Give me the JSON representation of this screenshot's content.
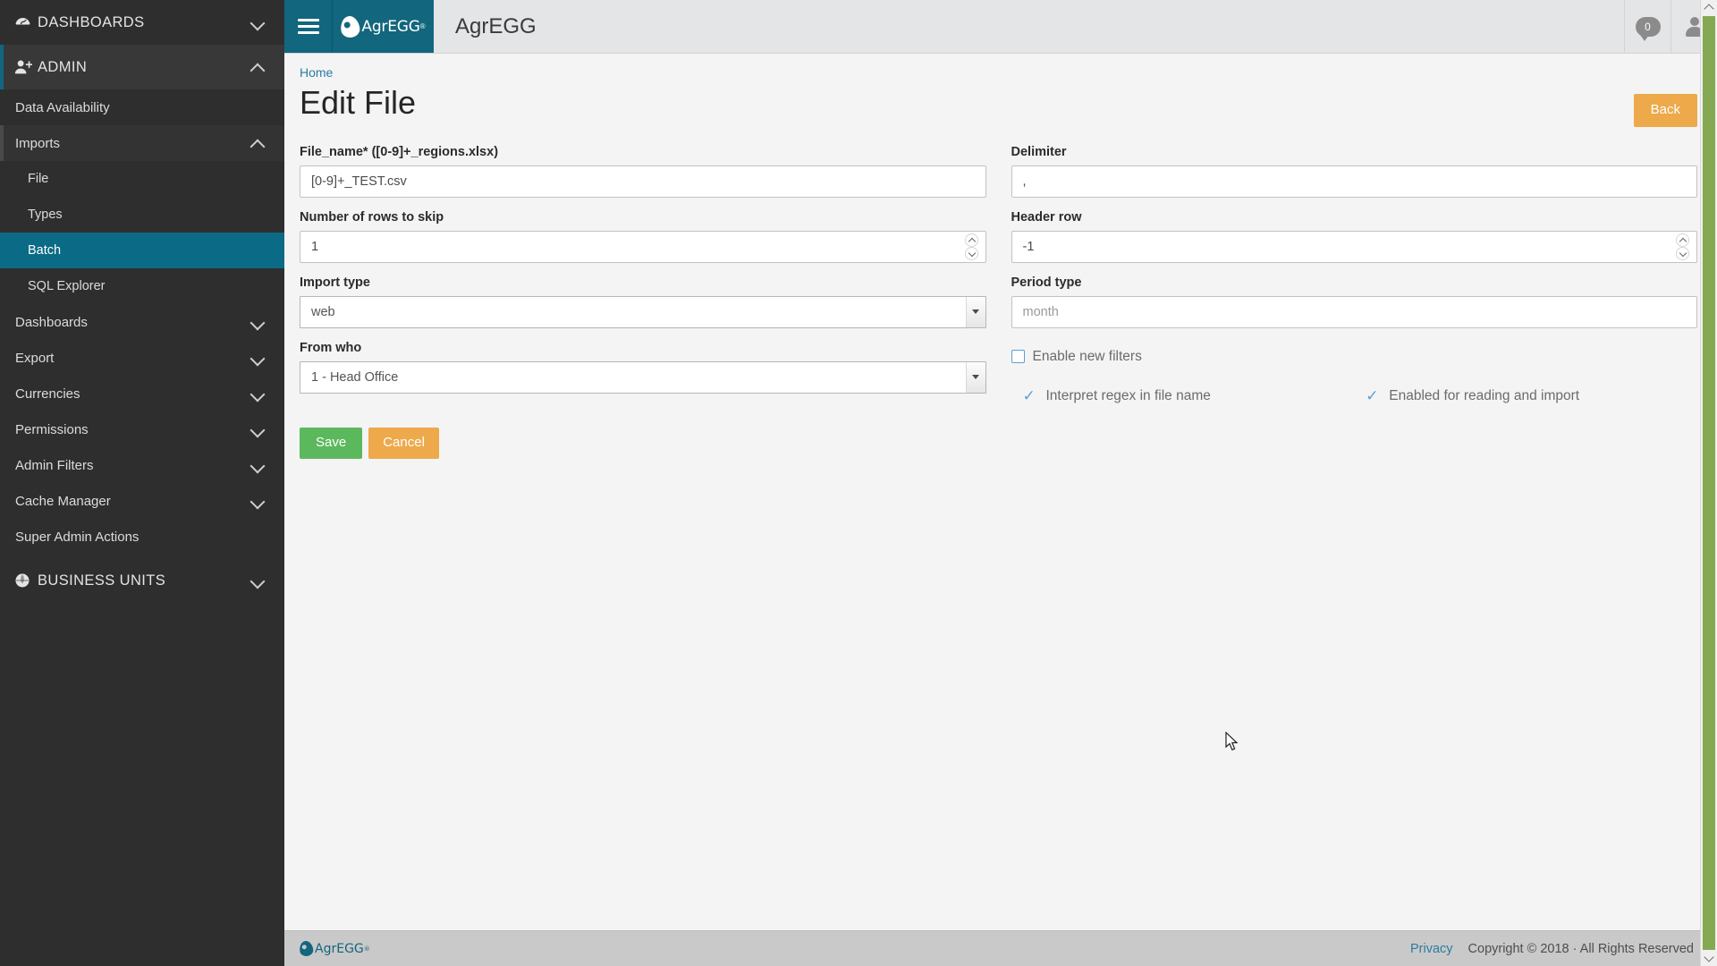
{
  "sidebar": {
    "groups": [
      {
        "label": "DASHBOARDS",
        "icon": "dashboard-gauge-icon",
        "expanded": false
      },
      {
        "label": "ADMIN",
        "icon": "user-add-icon",
        "expanded": true
      },
      {
        "label": "BUSINESS UNITS",
        "icon": "globe-icon",
        "expanded": false
      }
    ],
    "admin_items": [
      {
        "label": "Data Availability",
        "type": "item",
        "state": "normal"
      },
      {
        "label": "Imports",
        "type": "group",
        "state": "open"
      },
      {
        "label": "File",
        "type": "sub",
        "state": "normal"
      },
      {
        "label": "Types",
        "type": "sub",
        "state": "normal"
      },
      {
        "label": "Batch",
        "type": "sub",
        "state": "active"
      },
      {
        "label": "SQL Explorer",
        "type": "sub",
        "state": "normal"
      },
      {
        "label": "Dashboards",
        "type": "group",
        "state": "collapsed"
      },
      {
        "label": "Export",
        "type": "group",
        "state": "collapsed"
      },
      {
        "label": "Currencies",
        "type": "group",
        "state": "collapsed"
      },
      {
        "label": "Permissions",
        "type": "group",
        "state": "collapsed"
      },
      {
        "label": "Admin Filters",
        "type": "group",
        "state": "collapsed"
      },
      {
        "label": "Cache Manager",
        "type": "group",
        "state": "collapsed"
      },
      {
        "label": "Super Admin Actions",
        "type": "item",
        "state": "normal"
      }
    ]
  },
  "topbar": {
    "brand": "AgrEGG",
    "brand_reg": "®",
    "app_title": "AgrEGG",
    "menu_icon": "hamburger-menu-icon",
    "messages_count": "0",
    "messages_icon": "message-bubble-icon",
    "account_icon": "user-account-icon"
  },
  "breadcrumb": {
    "home": "Home"
  },
  "page": {
    "title": "Edit File",
    "back_label": "Back"
  },
  "form": {
    "left": {
      "file_name_label": "File_name* ([0-9]+_regions.xlsx)",
      "file_name_value": "[0-9]+_TEST.csv",
      "rows_skip_label": "Number of rows to skip",
      "rows_skip_value": "1",
      "import_type_label": "Import type",
      "import_type_value": "web",
      "import_type_options": [
        "web"
      ],
      "from_who_label": "From who",
      "from_who_value": "1 - Head Office",
      "from_who_options": [
        "1 - Head Office"
      ]
    },
    "right": {
      "delimiter_label": "Delimiter",
      "delimiter_value": ",",
      "header_row_label": "Header row",
      "header_row_value": "-1",
      "period_type_label": "Period type",
      "period_type_placeholder": "month",
      "enable_filters_label": "Enable new filters",
      "enable_filters_checked": false,
      "regex_label": "Interpret regex in file name",
      "regex_checked": true,
      "enabled_import_label": "Enabled for reading and import",
      "enabled_import_checked": true,
      "tick_glyph": "✓"
    }
  },
  "actions": {
    "save_label": "Save",
    "cancel_label": "Cancel"
  },
  "footer": {
    "brand": "AgrEGG",
    "brand_reg": "®",
    "privacy_label": "Privacy",
    "copyright": "Copyright © 2018 · All Rights Reserved"
  },
  "colors": {
    "brand_teal": "#12667e",
    "sidebar_bg": "#2e2e2e",
    "active_item": "#0b6a85",
    "save_green": "#5cb85c",
    "warn_orange": "#eda94a",
    "link_blue": "#2b7ca3",
    "scrollbar_green": "#85a853"
  }
}
